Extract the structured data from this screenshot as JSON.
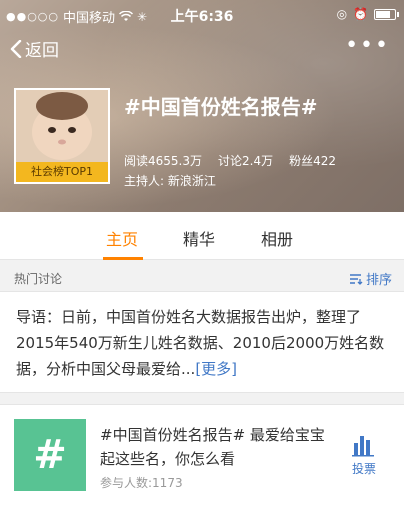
{
  "status_bar": {
    "signal": "●●○○○",
    "carrier": "中国移动",
    "time": "上午6:36"
  },
  "nav": {
    "back_label": "返回",
    "more_label": "•••"
  },
  "topic": {
    "badge": "社会榜TOP1",
    "title": "#中国首份姓名报告#",
    "stats": {
      "reads": "阅读4655.3万",
      "discussions": "讨论2.4万",
      "fans": "粉丝422"
    },
    "host": "主持人:  新浪浙江"
  },
  "tabs": [
    {
      "label": "主页"
    },
    {
      "label": "精华"
    },
    {
      "label": "相册"
    }
  ],
  "section": {
    "title": "热门讨论",
    "sort_label": "排序"
  },
  "intro": {
    "text": "导语：日前，中国首份姓名大数据报告出炉，整理了2015年540万新生儿姓名数据、2010后2000万姓名数据，分析中国父母最爱给...",
    "more": "[更多]"
  },
  "card": {
    "thumb_symbol": "#",
    "title": "#中国首份姓名报告# 最爱给宝宝起这些名，你怎么看",
    "participants": "参与人数:1173",
    "vote_label": "投票"
  },
  "colors": {
    "accent": "#ff8200",
    "link": "#4178c6",
    "badge": "#f3b71f",
    "thumb": "#58c393"
  }
}
